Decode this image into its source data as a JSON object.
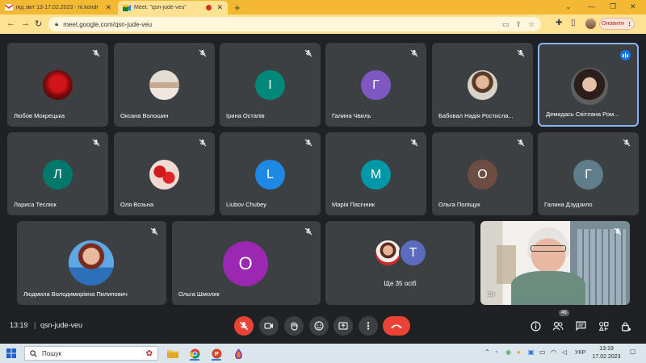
{
  "browser": {
    "tabs": [
      {
        "title": "інд звіт 13-17.02.2023 - m.kondr",
        "active": false,
        "favicon": "gmail-icon"
      },
      {
        "title": "Meet: \"qsn-jude-veu\"",
        "active": true,
        "favicon": "meet-icon"
      }
    ],
    "url": "meet.google.com/qsn-jude-veu",
    "update_label": "Оновити"
  },
  "participants": [
    {
      "name": "Любов Мокрецька",
      "avatar": "photo-rose",
      "muted": true
    },
    {
      "name": "Оксана Волошин",
      "avatar": "photo-group",
      "muted": true
    },
    {
      "name": "Ірина Остапів",
      "initial": "І",
      "color": "#00897b",
      "muted": true
    },
    {
      "name": "Галина Чвиль",
      "initial": "Г",
      "color": "#7e57c2",
      "muted": true
    },
    {
      "name": "Бабовал Надія Ростисла...",
      "avatar": "photo-woman",
      "muted": true
    },
    {
      "name": "Демидась Світлана Ром...",
      "avatar": "photo-woman-dark",
      "muted": false,
      "speaking": true
    },
    {
      "name": "Лариса Теслюк",
      "initial": "Л",
      "color": "#00796b",
      "muted": true
    },
    {
      "name": "Оля Возьна",
      "avatar": "photo-poppies",
      "muted": true
    },
    {
      "name": "Liubov Chubey",
      "initial": "L",
      "color": "#1e88e5",
      "muted": true
    },
    {
      "name": "Марія Пасічник",
      "initial": "М",
      "color": "#0097a7",
      "muted": true
    },
    {
      "name": "Ольга Поліщук",
      "initial": "О",
      "color": "#6d4c41",
      "muted": true
    },
    {
      "name": "Галина Дзудзило",
      "initial": "Г",
      "color": "#607d8b",
      "muted": true
    },
    {
      "name": "Людмила Володимирівна Пилипович",
      "avatar": "photo-lady-blue",
      "muted": true
    },
    {
      "name": "Ольга Шмолик",
      "initial": "О",
      "color": "#9c27b0",
      "muted": true
    }
  ],
  "others_tile": {
    "label": "Ще 35 осіб",
    "initial": "Т",
    "color": "#5c6bc0"
  },
  "self_tile": {
    "name": "Ви",
    "muted": true
  },
  "controls": {
    "time": "13:19",
    "separator": "|",
    "meeting_code": "qsn-jude-veu",
    "people_count": "49"
  },
  "taskbar": {
    "search_label": "Пошук",
    "language": "УКР",
    "time": "13:19",
    "date": "17.02.2023"
  },
  "colors": {
    "tab_bar": "#f4b932",
    "address_bar": "#fde293",
    "tile": "#3c4043",
    "end_call": "#ea4335",
    "speaking_border": "#8ab4f8"
  }
}
